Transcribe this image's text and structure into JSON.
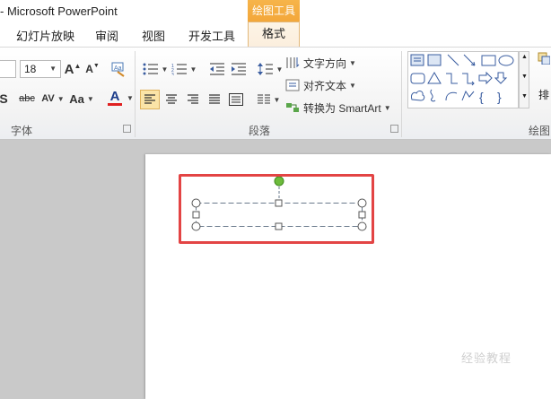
{
  "window": {
    "title": "- Microsoft PowerPoint"
  },
  "context_tab_group": {
    "label": "绘图工具"
  },
  "tabs": [
    {
      "label": "幻灯片放映"
    },
    {
      "label": "审阅"
    },
    {
      "label": "视图"
    },
    {
      "label": "开发工具"
    },
    {
      "label": "格式",
      "active": true
    }
  ],
  "font_group": {
    "label": "字体",
    "font_size": "18",
    "buttons": {
      "grow_font": "A",
      "shrink_font": "A",
      "shadow": "S",
      "strikethrough": "abc",
      "char_spacing": "AV",
      "change_case": "Aa",
      "font_color": "A"
    },
    "font_color_hex": "#e02020"
  },
  "paragraph_group": {
    "label": "段落",
    "text_direction": "文字方向",
    "align_text": "对齐文本",
    "convert_smartart": "转换为 SmartArt",
    "selected_alignment": "left"
  },
  "drawing_group": {
    "label": "绘图",
    "arrange_label": "排"
  },
  "icons": {
    "bullets": "bullet-list-icon",
    "numbering": "numbered-list-icon",
    "decrease_indent": "decrease-indent-icon",
    "increase_indent": "increase-indent-icon",
    "line_spacing": "line-spacing-icon",
    "columns": "columns-icon",
    "clear_format": "clear-format-icon"
  },
  "colors": {
    "highlight_red": "#e34444",
    "context_tab": "#f3a73a",
    "rotation_handle": "#6dbb3c"
  },
  "watermark": "经验教程"
}
